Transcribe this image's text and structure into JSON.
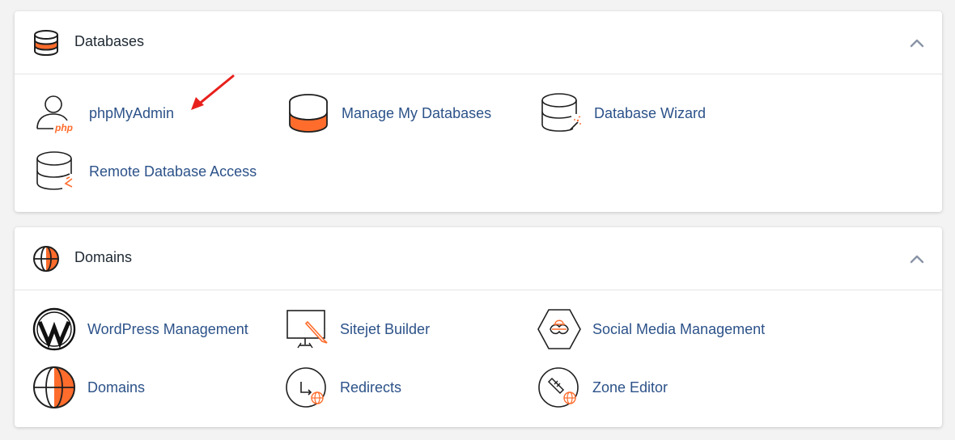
{
  "colors": {
    "accent": "#ff6c2c",
    "link": "#2c5289",
    "icon_stroke": "#1f1f1f",
    "arrow": "#e8201c"
  },
  "sections": {
    "databases": {
      "title": "Databases",
      "icon": "database-icon",
      "items": [
        {
          "label": "phpMyAdmin",
          "icon": "phpmyadmin-icon"
        },
        {
          "label": "Manage My Databases",
          "icon": "manage-databases-icon"
        },
        {
          "label": "Database Wizard",
          "icon": "database-wizard-icon"
        },
        {
          "label": "Remote Database Access",
          "icon": "remote-database-icon"
        }
      ]
    },
    "domains": {
      "title": "Domains",
      "icon": "globe-icon",
      "items": [
        {
          "label": "WordPress Management",
          "icon": "wordpress-icon"
        },
        {
          "label": "Sitejet Builder",
          "icon": "sitejet-icon"
        },
        {
          "label": "Social Media Management",
          "icon": "social-media-icon"
        },
        {
          "label": "Domains",
          "icon": "domains-globe-icon"
        },
        {
          "label": "Redirects",
          "icon": "redirects-icon"
        },
        {
          "label": "Zone Editor",
          "icon": "zone-editor-icon"
        }
      ]
    }
  },
  "php_badge": "php"
}
